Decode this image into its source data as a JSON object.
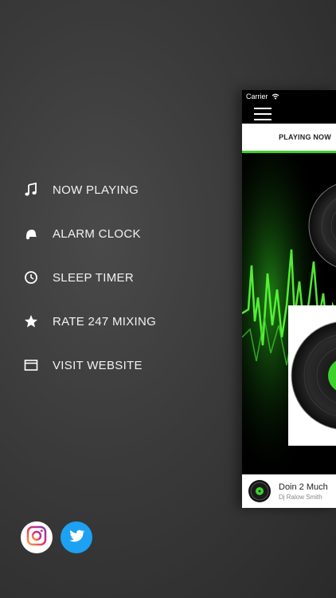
{
  "menu": {
    "items": [
      {
        "label": "NOW PLAYING",
        "icon": "music-note-icon"
      },
      {
        "label": "ALARM CLOCK",
        "icon": "alarm-bell-icon"
      },
      {
        "label": "SLEEP TIMER",
        "icon": "clock-icon"
      },
      {
        "label": "RATE 247 MIXING",
        "icon": "star-icon"
      },
      {
        "label": "VISIT WEBSITE",
        "icon": "browser-window-icon"
      }
    ]
  },
  "social": {
    "items": [
      {
        "name": "instagram",
        "icon": "instagram-icon",
        "color": "#ffffff"
      },
      {
        "name": "twitter",
        "icon": "twitter-icon",
        "color": "#1da1f2"
      }
    ]
  },
  "phone": {
    "status": {
      "carrier": "Carrier"
    },
    "tab": {
      "label": "PLAYING NOW"
    },
    "accent": "#3dd12b",
    "player": {
      "title": "Doin 2 Much",
      "artist": "Dj Ralow Smith"
    }
  }
}
